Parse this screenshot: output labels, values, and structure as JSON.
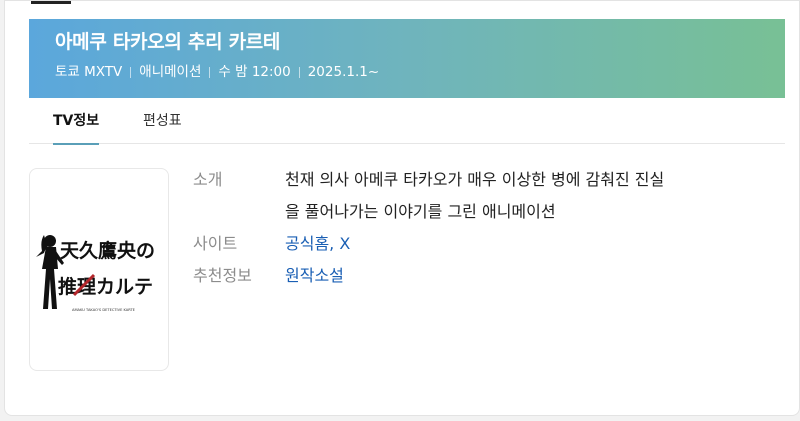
{
  "program": {
    "title": "아메쿠 타카오의 추리 카르테",
    "meta": [
      "토쿄 MXTV",
      "애니메이션",
      "수 밤 12:00",
      "2025.1.1~"
    ]
  },
  "tabs": [
    {
      "label": "TV정보",
      "active": true
    },
    {
      "label": "편성표",
      "active": false
    }
  ],
  "info": {
    "intro_label": "소개",
    "intro_line1": "천재 의사 아메쿠 타카오가 매우 이상한 병에 감춰진 진실",
    "intro_line2": "을 풀어나가는 이야기를 그린 애니메이션",
    "site_label": "사이트",
    "site_links": [
      "공식홈",
      "X"
    ],
    "rec_label": "추천정보",
    "rec_links": [
      "원작소설"
    ]
  },
  "poster": {
    "logo_line1": "天久鷹央の",
    "logo_line2": "推理カルテ",
    "logo_sub": "AMAKU TAKAO'S DETECTIVE KARTE"
  },
  "colors": {
    "header_gradient": [
      "#5ba7dc",
      "#78c095"
    ],
    "link": "#1a5fb4",
    "tab_indicator": "#5a9fb8"
  }
}
